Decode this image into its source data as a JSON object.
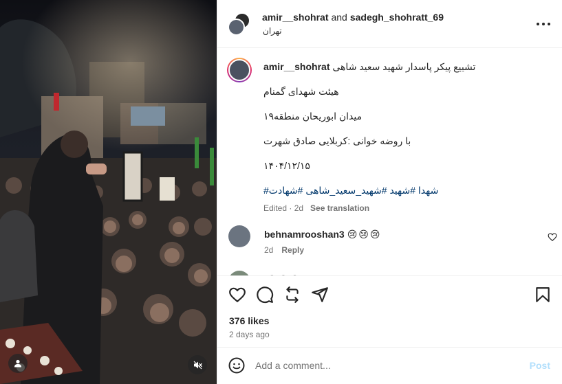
{
  "header": {
    "user1": "amir__shohrat",
    "and_text": "and",
    "user2": "sadegh_shohratt_69",
    "location": "تهران"
  },
  "caption": {
    "username": "amir__shohrat",
    "line1": "تشییع پیکر پاسدار شهید سعید شاهی",
    "line2": "هیئت شهدای گمنام",
    "line3": "میدان ابوریحان منطقه۱۹",
    "line4": "با روضه خوانی :کربلایی صادق شهرت",
    "line5": "۱۴۰۴/۱۲/۱۵",
    "hashtags": "#شهدا #شهید #شهید_سعید_شاهی #شهادت",
    "edited": "Edited · 2d",
    "see_translation": "See translation"
  },
  "comments": [
    {
      "username": "behnamrooshan3",
      "text": "😢😢😢",
      "age": "2d",
      "reply": "Reply"
    },
    {
      "username": "",
      "text": "😢😢😢",
      "age": "",
      "reply": ""
    }
  ],
  "stats": {
    "likes": "376 likes",
    "posted": "2 days ago"
  },
  "composer": {
    "placeholder": "Add a comment...",
    "post_label": "Post"
  },
  "media": {
    "icons": [
      "user-tag-icon",
      "mute-icon"
    ]
  },
  "colors": {
    "link": "#00376b",
    "secondary_text": "#737373",
    "post_disabled": "#b2dffc"
  }
}
